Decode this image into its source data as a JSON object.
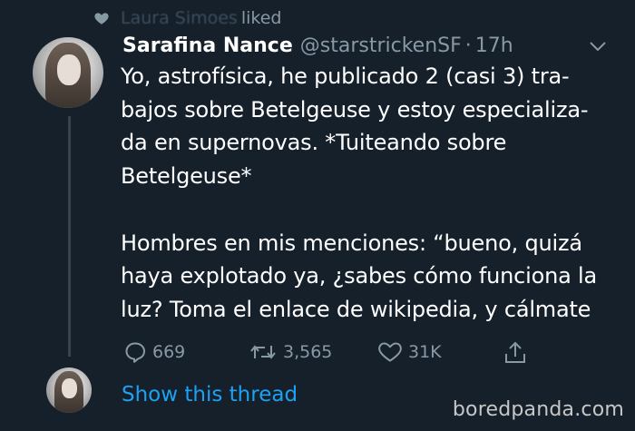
{
  "social_context": {
    "icon": "heart-icon",
    "liker_name": "Laura Simoes",
    "action_text": "liked"
  },
  "tweet": {
    "author_name": "Sarafina Nance",
    "handle": "@starstrickenSF",
    "separator": "·",
    "time_ago": "17h",
    "text": "Yo, astrofísica, he publicado 2 (casi 3) tra-\nbajos sobre Betelgeuse y estoy especializa-\nda en supernovas. *Tuiteando sobre\nBetelgeuse*\n\nHombres en mis menciones: “bueno, quizá\nhaya explotado ya, ¿sabes cómo funciona la\nluz? Toma el enlace de wikipedia,  y cálmate",
    "actions": {
      "replies": "669",
      "retweets": "3,565",
      "likes": "31K"
    }
  },
  "show_thread_label": "Show this thread",
  "watermark": "boredpanda.com",
  "colors": {
    "background": "#15202b",
    "muted": "#8899a6",
    "link": "#1da1f2",
    "thread_line": "#38444d"
  }
}
